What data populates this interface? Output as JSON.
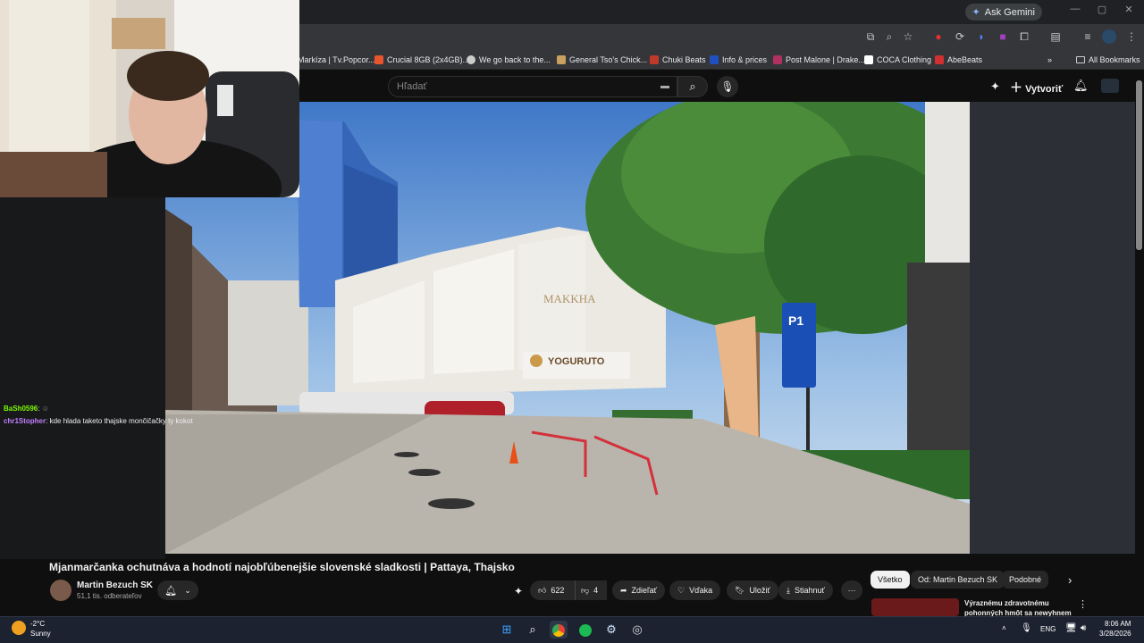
{
  "browser": {
    "ask_gemini": "Ask Gemini",
    "bookmarks": [
      {
        "label": "Markíza | Tv.Popcor...",
        "color": "#888888"
      },
      {
        "label": "Crucial 8GB (2x4GB)...",
        "color": "#e8542b"
      },
      {
        "label": "We go back to the...",
        "color": "#cccccc"
      },
      {
        "label": "General Tso's Chick...",
        "color": "#c8a060"
      },
      {
        "label": "Chuki Beats",
        "color": "#c0392b"
      },
      {
        "label": "Info & prices",
        "color": "#2050c0"
      },
      {
        "label": "Post Malone | Drake...",
        "color": "#b03060"
      },
      {
        "label": "COCA Clothing",
        "color": "#ffffff"
      },
      {
        "label": "AbeBeats",
        "color": "#d03030"
      }
    ],
    "all_bookmarks": "All Bookmarks"
  },
  "youtube": {
    "search_placeholder": "Hľadať",
    "create_label": "Vytvoriť"
  },
  "chat": [
    {
      "user": "BaSh0596",
      "user_color": "#7cfc00",
      "text": ""
    },
    {
      "user": "chr1Stopher",
      "user_color": "#c080ff",
      "text": "kde hlada taketo thajske mončičačky ty kokot"
    }
  ],
  "video": {
    "title": "Mjanmarčanka ochutnáva a hodnotí najobľúbenejšie slovenské sladkosti | Pattaya, Thajsko",
    "channel": "Martin Bezuch SK",
    "subscribers": "51,1 tis. odberateľov",
    "likes": "622",
    "dislikes": "4",
    "share": "Zdieľať",
    "thanks": "Vďaka",
    "save": "Uložiť",
    "download": "Stiahnuť",
    "scene_text": {
      "mall": "MAKKHA",
      "shop": "YOGURUTO",
      "parking": "P1"
    }
  },
  "chips": [
    "Všetko",
    "Od: Martin Bezuch SK",
    "Podobné"
  ],
  "recommended": {
    "title": "Výraznému zdravotnému pohonných hmôt sa newyhnem"
  },
  "taskbar": {
    "weather_temp": "-2°C",
    "weather_desc": "Sunny",
    "lang": "ENG",
    "time": "8:06 AM",
    "date": "3/28/2026"
  }
}
